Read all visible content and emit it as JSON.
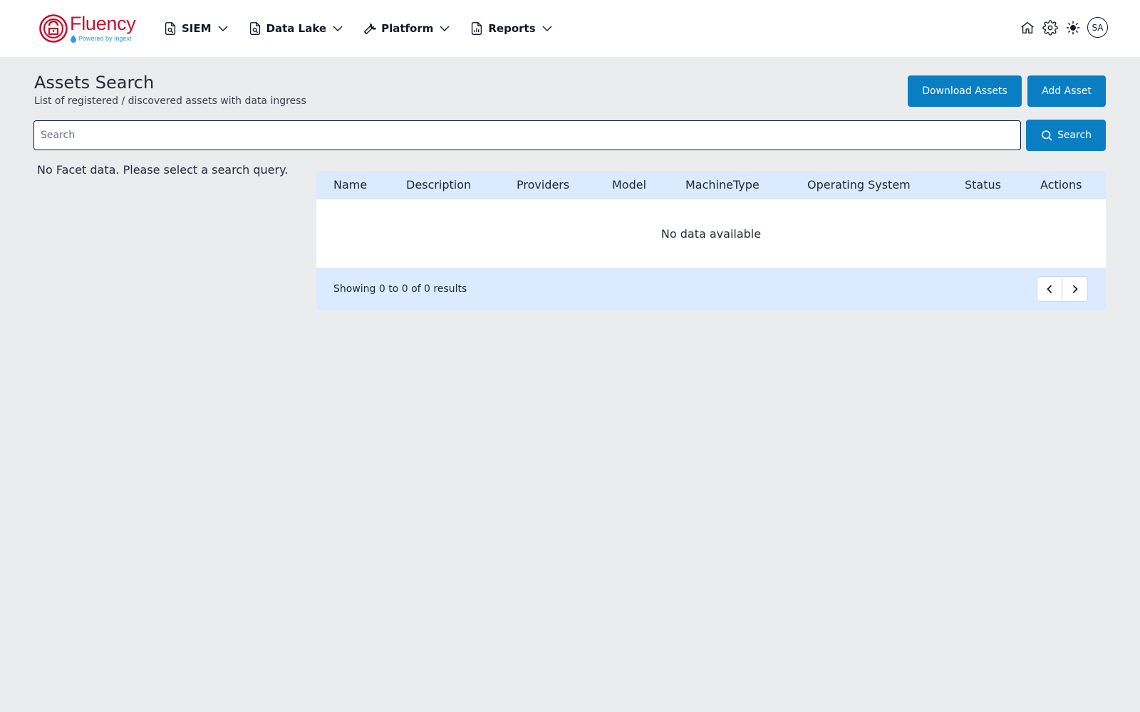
{
  "brand": {
    "name": "Fluency",
    "tagline": "Powered by Ingext",
    "primary_color": "#c8102e",
    "accent_color": "#0a7ec2"
  },
  "nav": {
    "items": [
      {
        "label": "SIEM",
        "icon": "file-search-icon"
      },
      {
        "label": "Data Lake",
        "icon": "file-search-icon"
      },
      {
        "label": "Platform",
        "icon": "wrench-icon"
      },
      {
        "label": "Reports",
        "icon": "file-chart-icon"
      }
    ]
  },
  "user": {
    "initials": "SA"
  },
  "header": {
    "title": "Assets Search",
    "subtitle": "List of registered / discovered assets with data ingress",
    "download_label": "Download Assets",
    "add_label": "Add Asset"
  },
  "search": {
    "placeholder": "Search",
    "value": "",
    "button_label": "Search"
  },
  "facets": {
    "empty_message": "No Facet data. Please select a search query."
  },
  "table": {
    "columns": [
      "Name",
      "Description",
      "Providers",
      "Model",
      "MachineType",
      "Operating System",
      "Status",
      "Actions"
    ],
    "rows": [],
    "empty_message": "No data available",
    "results_text": "Showing 0 to 0 of 0 results"
  }
}
